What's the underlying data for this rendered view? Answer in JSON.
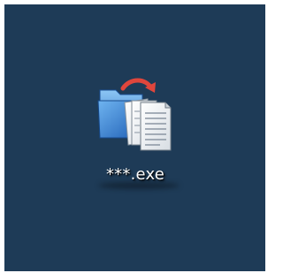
{
  "desktop": {
    "background_color": "#1e3b57",
    "icon": {
      "label": "***.exe",
      "icon_name": "folder-with-documents-icon",
      "accent_color": "#e0463c",
      "folder_color": "#3a82d6"
    }
  }
}
